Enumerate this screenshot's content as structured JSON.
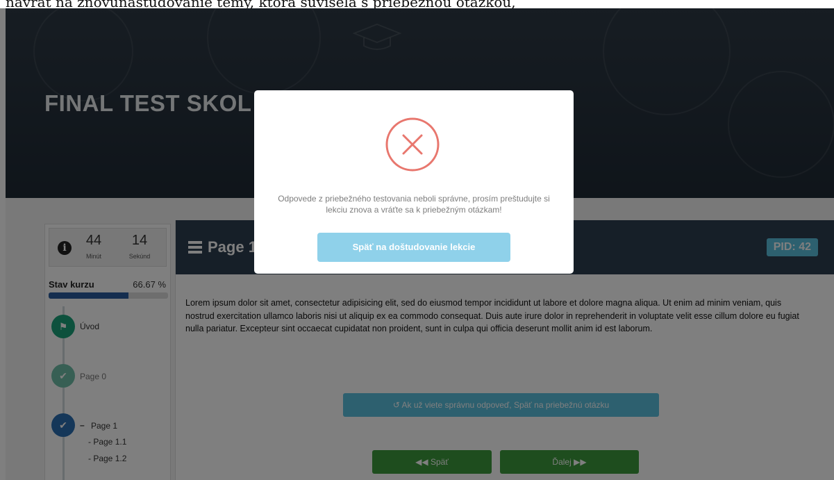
{
  "caption": "návrat na znovunaštudovanie témy, ktorá súvisela s priebežnou otázkou,",
  "hero": {
    "title": "FINAL TEST SKOL"
  },
  "timer": {
    "minutes": "44",
    "minutes_label": "Minút",
    "seconds": "14",
    "seconds_label": "Sekúnd"
  },
  "course_status": {
    "label": "Stav kurzu",
    "percent_text": "66.67 %",
    "progress": 0.6667
  },
  "nav": {
    "intro": "Úvod",
    "page0": "Page 0",
    "page1": "Page 1",
    "page1_prefix": "–",
    "page1_1": "- Page 1.1",
    "page1_2": "- Page 1.2"
  },
  "content": {
    "title": "Page 1",
    "pid": "PID: 42",
    "body": "Lorem ipsum dolor sit amet, consectetur adipisicing elit, sed do eiusmod tempor incididunt ut labore et dolore magna aliqua. Ut enim ad minim veniam, quis nostrud exercitation ullamco laboris nisi ut aliquip ex ea commodo consequat. Duis aute irure dolor in reprehenderit in voluptate velit esse cillum dolore eu fugiat nulla pariatur. Excepteur sint occaecat cupidatat non proident, sunt in culpa qui officia deserunt mollit anim id est laborum.",
    "back_to_question": "↺ Ak už viete správnu odpoveď, Späť na priebežnú otázku",
    "prev": "◀◀ Späť",
    "next": "Ďalej ▶▶"
  },
  "modal": {
    "message": "Odpovede z priebežného testovania neboli správne, prosím preštudujte si lekciu znova a vráťte sa k priebežným otázkam!",
    "button": "Späť na doštudovanie lekcie"
  },
  "colors": {
    "error": "#e8776e",
    "info": "#5bc0de",
    "success": "#3c9a3c",
    "header": "#2c3e50",
    "node_green": "#1aa37a",
    "node_blue": "#2a6fb3"
  }
}
